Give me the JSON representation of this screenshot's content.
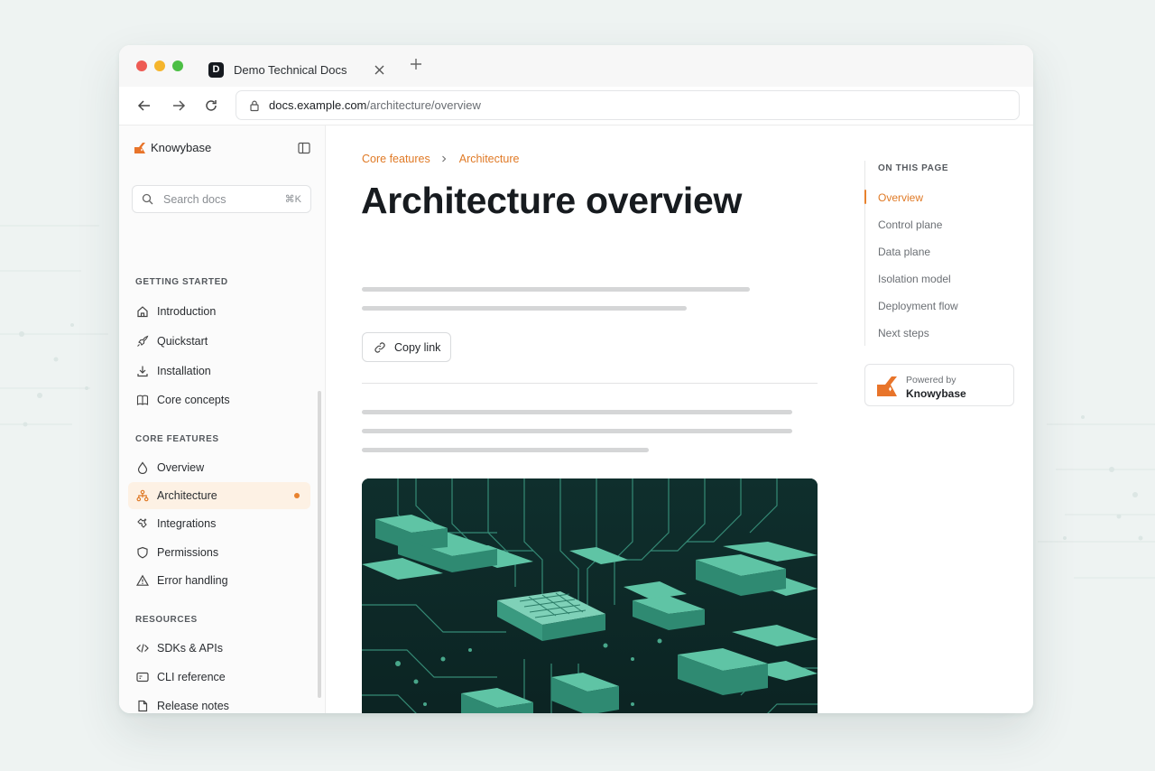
{
  "browser": {
    "tab": {
      "favicon_letter": "D",
      "title": "Demo Technical Docs"
    },
    "url": {
      "host": "docs.example.com",
      "path": "/architecture/overview"
    }
  },
  "sidebar": {
    "brand": "Knowybase",
    "search": {
      "placeholder": "Search docs",
      "shortcut": "⌘K"
    },
    "sections": [
      {
        "label": "GETTING STARTED",
        "items": [
          {
            "label": "Introduction",
            "icon": "home-icon"
          },
          {
            "label": "Quickstart",
            "icon": "rocket-icon"
          },
          {
            "label": "Installation",
            "icon": "download-icon"
          },
          {
            "label": "Core concepts",
            "icon": "book-icon"
          }
        ]
      },
      {
        "label": "CORE FEATURES",
        "items": [
          {
            "label": "Overview",
            "icon": "drop-icon"
          },
          {
            "label": "Architecture",
            "icon": "hierarchy-icon",
            "active": true
          },
          {
            "label": "Integrations",
            "icon": "puzzle-icon"
          },
          {
            "label": "Permissions",
            "icon": "shield-icon"
          },
          {
            "label": "Error handling",
            "icon": "warning-icon"
          }
        ]
      },
      {
        "label": "RESOURCES",
        "items": [
          {
            "label": "SDKs & APIs",
            "icon": "code-icon"
          },
          {
            "label": "CLI reference",
            "icon": "terminal-icon"
          },
          {
            "label": "Release notes",
            "icon": "file-icon"
          }
        ]
      }
    ]
  },
  "main": {
    "breadcrumb": [
      "Core features",
      "Architecture"
    ],
    "title": "Architecture overview",
    "copy_link_label": "Copy link"
  },
  "toc": {
    "heading": "ON THIS PAGE",
    "items": [
      "Overview",
      "Control plane",
      "Data plane",
      "Isolation model",
      "Deployment flow",
      "Next steps"
    ],
    "active_index": 0
  },
  "powered_by": {
    "small": "Powered by",
    "big": "Knowybase"
  },
  "colors": {
    "accent": "#e8822e",
    "active_bg": "#fdf1e4",
    "hero_bg": "#0e2a29",
    "hero_block": "#5fc4a5"
  }
}
